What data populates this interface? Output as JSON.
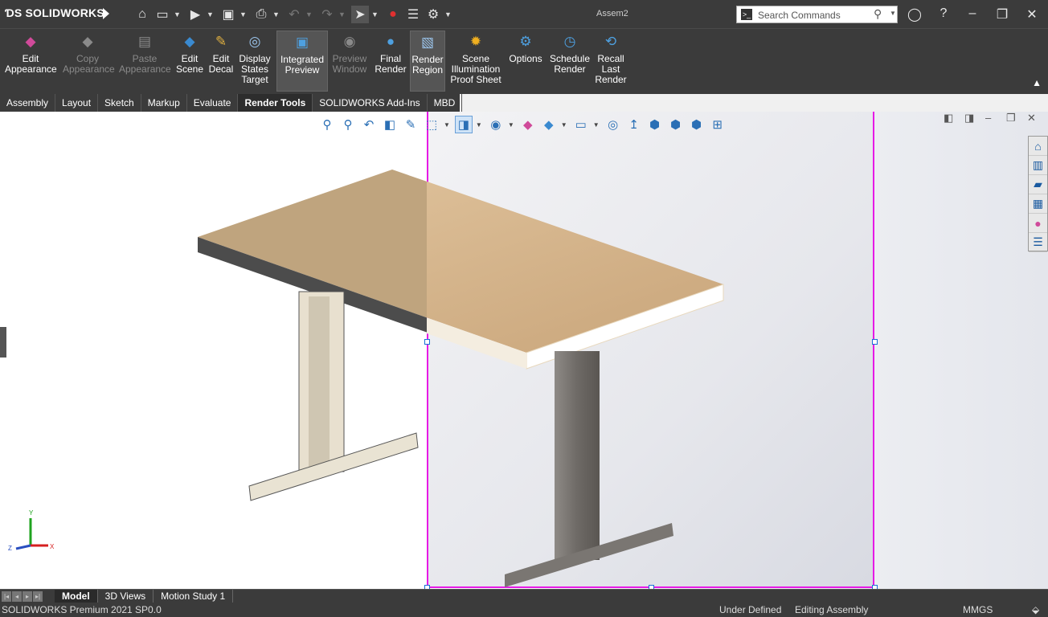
{
  "app": {
    "logo_brand": "SOLIDWORKS",
    "window_title": "Assem2"
  },
  "search": {
    "placeholder": "Search Commands"
  },
  "ribbon": {
    "buttons": [
      {
        "label": "Edit\nAppearance",
        "state": "enabled"
      },
      {
        "label": "Copy\nAppearance",
        "state": "disabled"
      },
      {
        "label": "Paste\nAppearance",
        "state": "disabled"
      },
      {
        "label": "Edit\nScene",
        "state": "enabled"
      },
      {
        "label": "Edit\nDecal",
        "state": "enabled"
      },
      {
        "label": "Display\nStates\nTarget",
        "state": "enabled"
      },
      {
        "label": "Integrated\nPreview",
        "state": "active"
      },
      {
        "label": "Preview\nWindow",
        "state": "disabled"
      },
      {
        "label": "Final\nRender",
        "state": "enabled"
      },
      {
        "label": "Render\nRegion",
        "state": "active"
      },
      {
        "label": "Scene\nIllumination\nProof Sheet",
        "state": "enabled"
      },
      {
        "label": "Options",
        "state": "enabled"
      },
      {
        "label": "Schedule\nRender",
        "state": "enabled"
      },
      {
        "label": "Recall\nLast\nRender",
        "state": "enabled"
      }
    ]
  },
  "tabs": [
    "Assembly",
    "Layout",
    "Sketch",
    "Markup",
    "Evaluate",
    "Render Tools",
    "SOLIDWORKS Add-Ins",
    "MBD"
  ],
  "active_tab": "Render Tools",
  "triad": {
    "y": "Y",
    "x": "X",
    "z": "Z"
  },
  "bottom_tabs": [
    "Model",
    "3D Views",
    "Motion Study 1"
  ],
  "status": {
    "product": "SOLIDWORKS Premium 2021 SP0.0",
    "definition": "Under Defined",
    "mode": "Editing Assembly",
    "units": "MMGS"
  },
  "colors": {
    "render_region_border": "#e61ae6",
    "chrome": "#3b3b3b",
    "tabletop": "#d9bc95"
  }
}
